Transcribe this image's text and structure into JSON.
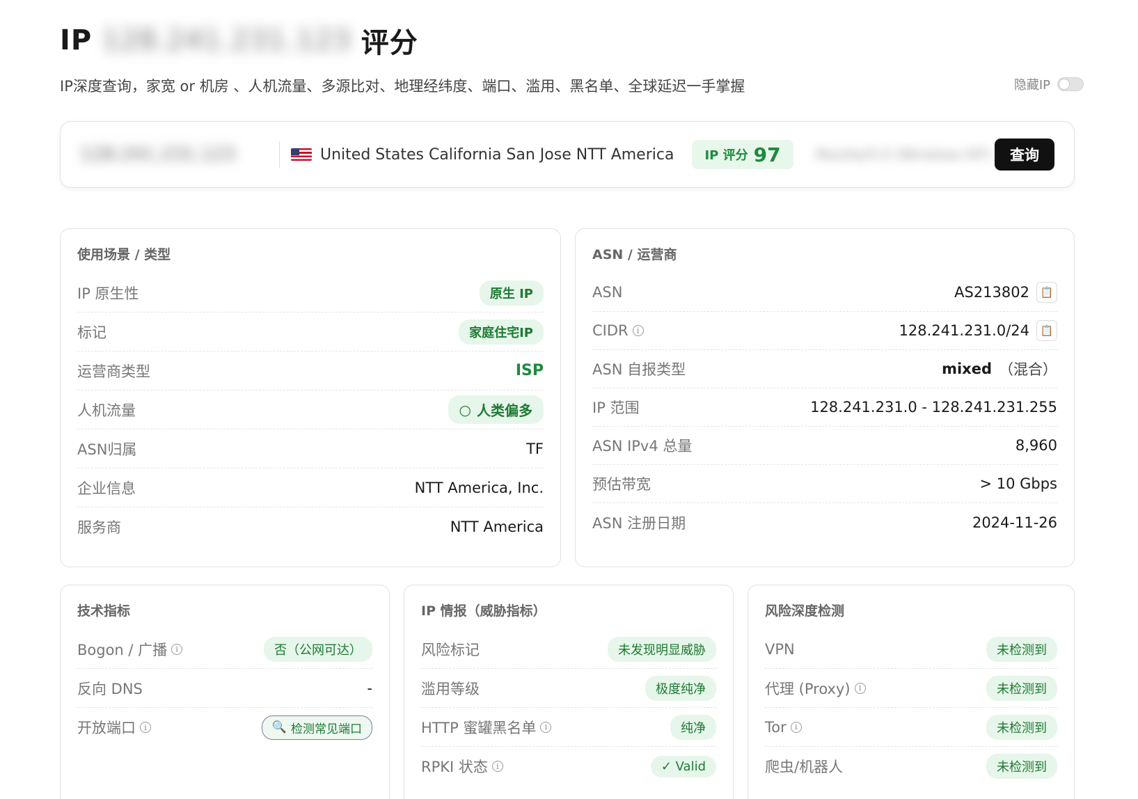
{
  "header": {
    "title_prefix": "IP",
    "title_ip": "128.241.231.123",
    "title_suffix": "评分",
    "subtitle": "IP深度查询，家宽 or 机房 、人机流量、多源比对、地理经纬度、端口、滥用、黑名单、全球延迟一手掌握",
    "hide_ip_label": "隐藏IP",
    "hide_ip_on": false
  },
  "searchbar": {
    "ip": "128.241.231.123",
    "flag": "us-flag",
    "location": "United States California San Jose NTT America",
    "score_label": "IP 评分",
    "score_value": "97",
    "extra": "Mozilla/5.0 (Windows NT)",
    "query_button": "查询"
  },
  "usage_card": {
    "title": "使用场景 / 类型",
    "rows": [
      {
        "label": "IP 原生性",
        "value": "原生 IP"
      },
      {
        "label": "标记",
        "value": "家庭住宅IP"
      },
      {
        "label": "运营商类型",
        "value": "ISP"
      },
      {
        "label": "人机流量",
        "value": "人类偏多"
      },
      {
        "label": "ASN归属",
        "value": "TF"
      },
      {
        "label": "企业信息",
        "value": "NTT America, Inc."
      },
      {
        "label": "服务商",
        "value": "NTT America"
      }
    ]
  },
  "asn_card": {
    "title": "ASN / 运营商",
    "rows": [
      {
        "label": "ASN",
        "value": "AS213802"
      },
      {
        "label": "CIDR",
        "value": "128.241.231.0/24"
      },
      {
        "label": "ASN 自报类型",
        "value": "mixed",
        "value_note": "（混合）"
      },
      {
        "label": "IP 范围",
        "value": "128.241.231.0 - 128.241.231.255"
      },
      {
        "label": "ASN IPv4 总量",
        "value": "8,960"
      },
      {
        "label": "预估带宽",
        "value": "> 10 Gbps"
      },
      {
        "label": "ASN 注册日期",
        "value": "2024-11-26"
      }
    ]
  },
  "tech_card": {
    "title": "技术指标",
    "rows": [
      {
        "label": "Bogon / 广播",
        "value": "否（公网可达）"
      },
      {
        "label": "反向 DNS",
        "value": "-"
      },
      {
        "label": "开放端口",
        "value": "检测常见端口"
      }
    ]
  },
  "intel_card": {
    "title": "IP 情报（威胁指标）",
    "rows": [
      {
        "label": "风险标记",
        "value": "未发现明显威胁"
      },
      {
        "label": "滥用等级",
        "value": "极度纯净"
      },
      {
        "label": "HTTP 蜜罐黑名单",
        "value": "纯净"
      },
      {
        "label": "RPKI 状态",
        "value": "✓ Valid"
      }
    ]
  },
  "risk_card": {
    "title": "风险深度检测",
    "rows": [
      {
        "label": "VPN",
        "value": "未检测到"
      },
      {
        "label": "代理 (Proxy)",
        "value": "未检测到"
      },
      {
        "label": "Tor",
        "value": "未检测到"
      },
      {
        "label": "爬虫/机器人",
        "value": "未检测到"
      }
    ]
  },
  "colors": {
    "accent_green": "#1e8a3c",
    "pill_bg": "#e6f6ea",
    "button": "#111111"
  }
}
